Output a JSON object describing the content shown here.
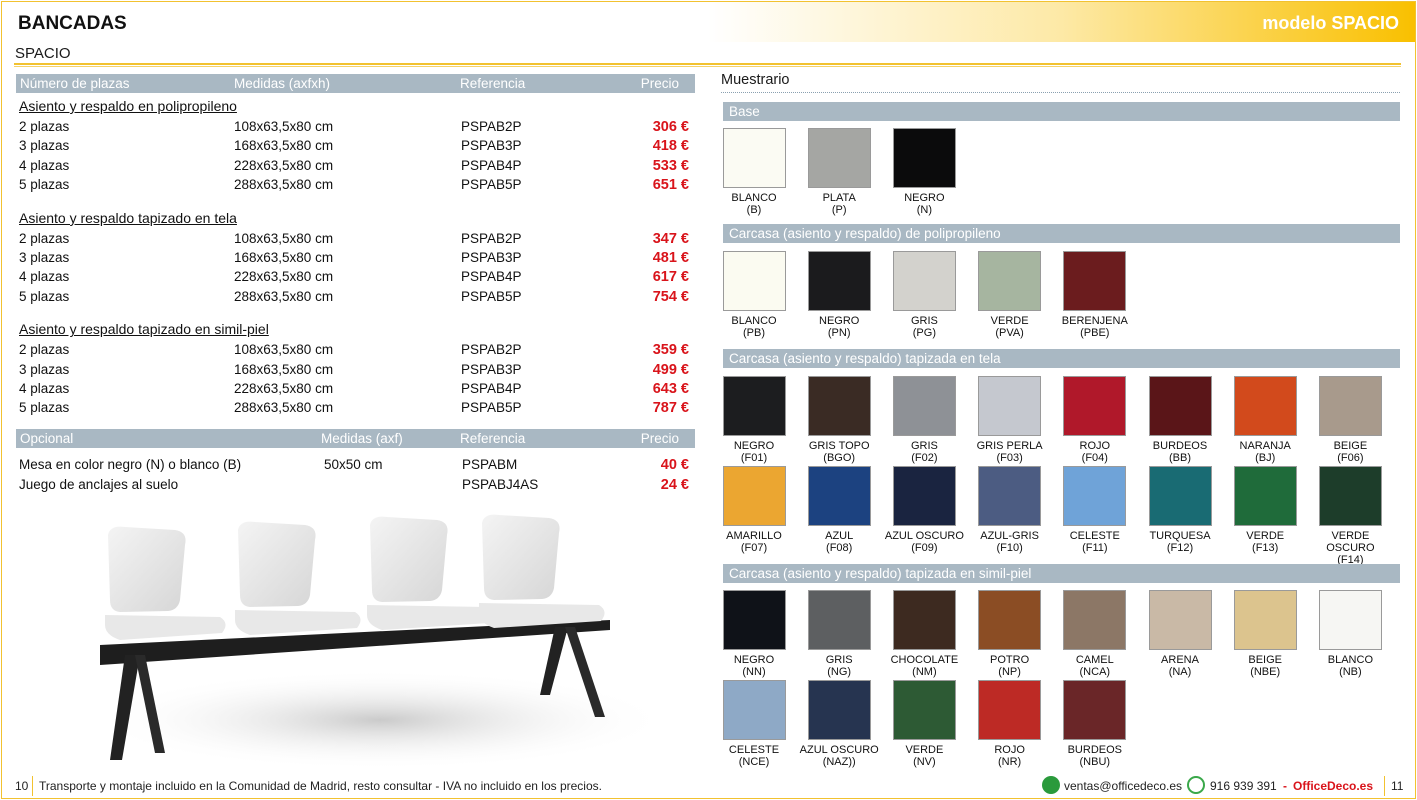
{
  "header": {
    "title": "BANCADAS",
    "model": "modelo SPACIO",
    "subtitle": "SPACIO"
  },
  "main_table": {
    "headers": [
      "Número de plazas",
      "Medidas (axfxh)",
      "Referencia",
      "Precio"
    ],
    "groups": [
      {
        "title": "Asiento y respaldo en polipropileno",
        "rows": [
          [
            "2 plazas",
            "108x63,5x80 cm",
            "PSPAB2P",
            "306 €"
          ],
          [
            "3 plazas",
            "168x63,5x80 cm",
            "PSPAB3P",
            "418 €"
          ],
          [
            "4 plazas",
            "228x63,5x80 cm",
            "PSPAB4P",
            "533 €"
          ],
          [
            "5 plazas",
            "288x63,5x80 cm",
            "PSPAB5P",
            "651 €"
          ]
        ]
      },
      {
        "title": "Asiento y respaldo tapizado en tela",
        "rows": [
          [
            "2 plazas",
            "108x63,5x80 cm",
            "PSPAB2P",
            "347 €"
          ],
          [
            "3 plazas",
            "168x63,5x80 cm",
            "PSPAB3P",
            "481 €"
          ],
          [
            "4 plazas",
            "228x63,5x80 cm",
            "PSPAB4P",
            "617 €"
          ],
          [
            "5 plazas",
            "288x63,5x80 cm",
            "PSPAB5P",
            "754 €"
          ]
        ]
      },
      {
        "title": "Asiento y respaldo tapizado en simil-piel",
        "rows": [
          [
            "2 plazas",
            "108x63,5x80 cm",
            "PSPAB2P",
            "359 €"
          ],
          [
            "3 plazas",
            "168x63,5x80 cm",
            "PSPAB3P",
            "499 €"
          ],
          [
            "4 plazas",
            "228x63,5x80 cm",
            "PSPAB4P",
            "643 €"
          ],
          [
            "5 plazas",
            "288x63,5x80 cm",
            "PSPAB5P",
            "787 €"
          ]
        ]
      }
    ]
  },
  "optional_table": {
    "headers": [
      "Opcional",
      "Medidas (axf)",
      "Referencia",
      "Precio"
    ],
    "rows": [
      [
        "Mesa en color negro (N) o blanco (B)",
        "50x50 cm",
        "PSPABM",
        "40 €"
      ],
      [
        "Juego de anclajes al suelo",
        "",
        "PSPABJ4AS",
        "24 €"
      ]
    ]
  },
  "samples": {
    "title": "Muestrario",
    "sections": [
      {
        "title": "Base",
        "items": [
          {
            "name": "BLANCO",
            "code": "(B)",
            "color": "#fbfbf3"
          },
          {
            "name": "PLATA",
            "code": "(P)",
            "color": "#a5a6a3"
          },
          {
            "name": "NEGRO",
            "code": "(N)",
            "color": "#0b0b0c"
          }
        ]
      },
      {
        "title": "Carcasa (asiento y respaldo) de polipropileno",
        "items": [
          {
            "name": "BLANCO",
            "code": "(PB)",
            "color": "#fbfbf1"
          },
          {
            "name": "NEGRO",
            "code": "(PN)",
            "color": "#1b1b1d"
          },
          {
            "name": "GRIS",
            "code": "(PG)",
            "color": "#d3d2cd"
          },
          {
            "name": "VERDE",
            "code": "(PVA)",
            "color": "#a6b5a0"
          },
          {
            "name": "BERENJENA",
            "code": "(PBE)",
            "color": "#6b1c1e"
          }
        ]
      },
      {
        "title": "Carcasa (asiento y respaldo) tapizada en tela",
        "items": [
          {
            "name": "NEGRO",
            "code": "(F01)",
            "color": "#1c1d1f"
          },
          {
            "name": "GRIS TOPO",
            "code": "(BGO)",
            "color": "#3a2b24"
          },
          {
            "name": "GRIS",
            "code": "(F02)",
            "color": "#8e9196"
          },
          {
            "name": "GRIS PERLA",
            "code": "(F03)",
            "color": "#c5c8cf"
          },
          {
            "name": "ROJO",
            "code": "(F04)",
            "color": "#b0182a"
          },
          {
            "name": "BURDEOS",
            "code": "(BB)",
            "color": "#5a1518"
          },
          {
            "name": "NARANJA",
            "code": "(BJ)",
            "color": "#d24a1c"
          },
          {
            "name": "BEIGE",
            "code": "(F06)",
            "color": "#a89a8c"
          },
          {
            "name": "AMARILLO",
            "code": "(F07)",
            "color": "#eba631"
          },
          {
            "name": "AZUL",
            "code": "(F08)",
            "color": "#1c4280"
          },
          {
            "name": "AZUL OSCURO",
            "code": "(F09)",
            "color": "#1a2440"
          },
          {
            "name": "AZUL-GRIS",
            "code": "(F10)",
            "color": "#4c5c82"
          },
          {
            "name": "CELESTE",
            "code": "(F11)",
            "color": "#6fa3d8"
          },
          {
            "name": "TURQUESA",
            "code": "(F12)",
            "color": "#196b73"
          },
          {
            "name": "VERDE",
            "code": "(F13)",
            "color": "#1f6b3a"
          },
          {
            "name": "VERDE OSCURO",
            "code": "(F14)",
            "color": "#1d3d2a"
          }
        ]
      },
      {
        "title": "Carcasa (asiento y respaldo) tapizada en simil-piel",
        "items": [
          {
            "name": "NEGRO",
            "code": "(NN)",
            "color": "#0f1218"
          },
          {
            "name": "GRIS",
            "code": "(NG)",
            "color": "#5d5f61"
          },
          {
            "name": "CHOCOLATE",
            "code": "(NM)",
            "color": "#3d2a20"
          },
          {
            "name": "POTRO",
            "code": "(NP)",
            "color": "#8b4d24"
          },
          {
            "name": "CAMEL",
            "code": "(NCA)",
            "color": "#8c7766"
          },
          {
            "name": "ARENA",
            "code": "(NA)",
            "color": "#c9b9a6"
          },
          {
            "name": "BEIGE",
            "code": "(NBE)",
            "color": "#dcc48e"
          },
          {
            "name": "BLANCO",
            "code": "(NB)",
            "color": "#f6f6f3"
          },
          {
            "name": "CELESTE",
            "code": "(NCE)",
            "color": "#8ea9c6"
          },
          {
            "name": "AZUL OSCURO",
            "code": "(NAZ))",
            "color": "#263450"
          },
          {
            "name": "VERDE",
            "code": "(NV)",
            "color": "#2d5a34"
          },
          {
            "name": "ROJO",
            "code": "(NR)",
            "color": "#bd2a25"
          },
          {
            "name": "BURDEOS",
            "code": "(NBU)",
            "color": "#6a2628"
          }
        ]
      }
    ]
  },
  "footer": {
    "page_left": "10",
    "note": "Transporte y montaje incluido en la Comunidad de Madrid, resto consultar - IVA no incluido en los precios.",
    "email": "ventas@officedeco.es",
    "phone": "916 939 391",
    "dash": "-",
    "brand": "OfficeDeco.es",
    "page_right": "11",
    "email_icon_color": "#2a9a3c",
    "phone_icon_color": "#3aa84a"
  }
}
